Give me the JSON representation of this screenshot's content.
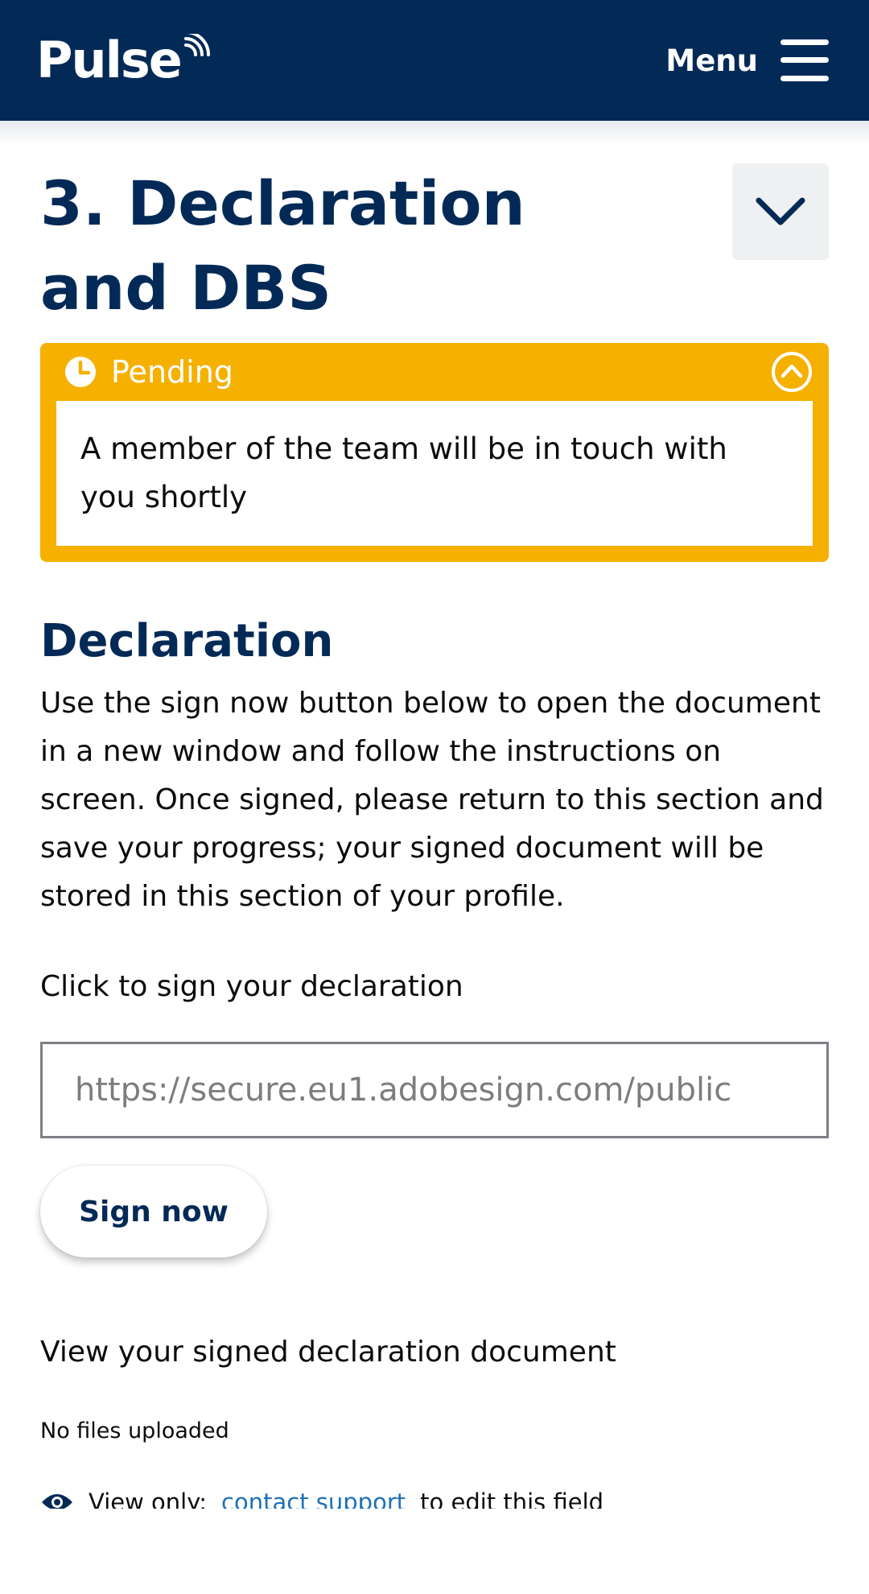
{
  "header": {
    "logo_text": "Pulse",
    "menu_label": "Menu",
    "background": "#032a57"
  },
  "section": {
    "title": "3. Declaration and DBS",
    "toggle_icon": "chevron-down-icon"
  },
  "status": {
    "label": "Pending",
    "message": "A member of the team will be in touch with you shortly",
    "color": "#f5b000",
    "icon": "clock-icon",
    "collapse_icon": "chevron-up-circle-icon"
  },
  "declaration": {
    "heading": "Declaration",
    "instructions": "Use the sign now button below to open the document in a new window and follow the instructions on screen. Once signed, please return to this section and save your progress; your signed document will be stored in this section of your profile.",
    "field_label": "Click to sign your declaration",
    "url_value": "https://secure.eu1.adobesign.com/public",
    "sign_button": "Sign now"
  },
  "signed_document": {
    "label": "View your signed declaration document",
    "files_status": "No files uploaded",
    "view_only_prefix": "View only:",
    "contact_link": "contact support",
    "view_only_suffix": "to edit this field"
  }
}
